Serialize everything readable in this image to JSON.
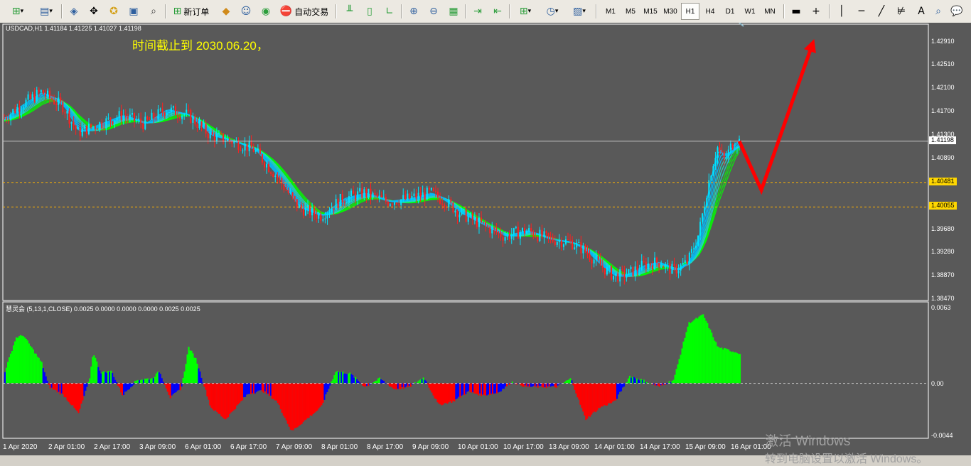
{
  "toolbar": {
    "new_order_label": "新订单",
    "autotrade_label": "自动交易",
    "timeframes": [
      "M1",
      "M5",
      "M15",
      "M30",
      "H1",
      "H4",
      "D1",
      "W1",
      "MN"
    ],
    "active_timeframe": "H1"
  },
  "chart": {
    "symbol_info": "USDCAD,H1  1.41184 1.41225 1.41027 1.41198",
    "annotation": "时间截止到 2030.06.20，",
    "price_labels": [
      "1.42910",
      "1.42510",
      "1.42100",
      "1.41700",
      "1.41300",
      "1.40890",
      "1.39680",
      "1.39280",
      "1.38870",
      "1.38470"
    ],
    "current_price": "1.41198",
    "level_labels": [
      "1.40481",
      "1.40055"
    ],
    "indicator_info": "慧灵会 (5,13,1,CLOSE) 0.0025 0.0000 0.0000 0.0000 0.0025 0.0025",
    "indicator_labels": [
      "0.0063",
      "0.00",
      "-0.0044"
    ],
    "time_labels": [
      "1 Apr 2020",
      "2 Apr 01:00",
      "2 Apr 17:00",
      "3 Apr 09:00",
      "6 Apr 01:00",
      "6 Apr 17:00",
      "7 Apr 09:00",
      "8 Apr 01:00",
      "8 Apr 17:00",
      "9 Apr 09:00",
      "10 Apr 01:00",
      "10 Apr 17:00",
      "13 Apr 09:00",
      "14 Apr 01:00",
      "14 Apr 17:00",
      "15 Apr 09:00",
      "16 Apr 01:00"
    ],
    "watermark_line1": "激活 Windows",
    "watermark_line2": "转到电脑设置以激活 Windows。"
  },
  "colors": {
    "background": "#595959",
    "bull_candle": "#00e5ff",
    "bear_candle": "#ff2020",
    "ribbon_green": "#00ff00",
    "ribbon_blue": "#00bfff",
    "histogram_green": "#00ff00",
    "histogram_red": "#ff0000",
    "histogram_blue": "#0000ff",
    "level_line": "#ffb400",
    "annotation": "#ffff00",
    "forecast_arrow": "#ff0000"
  },
  "chart_data": {
    "type": "candlestick",
    "symbol": "USDCAD",
    "timeframe": "H1",
    "close_path": [
      [
        0,
        1.416
      ],
      [
        0.02,
        1.418
      ],
      [
        0.05,
        1.4205
      ],
      [
        0.08,
        1.418
      ],
      [
        0.1,
        1.4135
      ],
      [
        0.13,
        1.415
      ],
      [
        0.16,
        1.4165
      ],
      [
        0.19,
        1.415
      ],
      [
        0.22,
        1.4175
      ],
      [
        0.25,
        1.4165
      ],
      [
        0.28,
        1.413
      ],
      [
        0.31,
        1.412
      ],
      [
        0.34,
        1.4105
      ],
      [
        0.37,
        1.406
      ],
      [
        0.4,
        1.4005
      ],
      [
        0.43,
        1.399
      ],
      [
        0.46,
        1.402
      ],
      [
        0.49,
        1.403
      ],
      [
        0.52,
        1.4015
      ],
      [
        0.55,
        1.402
      ],
      [
        0.58,
        1.403
      ],
      [
        0.6,
        1.4015
      ],
      [
        0.62,
        1.3995
      ],
      [
        0.65,
        1.3975
      ],
      [
        0.68,
        1.3955
      ],
      [
        0.71,
        1.3965
      ],
      [
        0.74,
        1.395
      ],
      [
        0.77,
        1.3945
      ],
      [
        0.79,
        1.393
      ],
      [
        0.81,
        1.3905
      ],
      [
        0.83,
        1.3885
      ],
      [
        0.85,
        1.389
      ],
      [
        0.87,
        1.3905
      ],
      [
        0.89,
        1.391
      ],
      [
        0.91,
        1.3895
      ],
      [
        0.93,
        1.391
      ],
      [
        0.945,
        1.396
      ],
      [
        0.96,
        1.406
      ],
      [
        0.97,
        1.411
      ],
      [
        0.98,
        1.4085
      ],
      [
        0.99,
        1.4115
      ],
      [
        1.0,
        1.412
      ]
    ],
    "forecast_path": [
      [
        1.0,
        1.41198
      ],
      [
        1.03,
        1.4035
      ],
      [
        1.1,
        1.429
      ]
    ],
    "levels": [
      1.40481,
      1.40055
    ],
    "current_price": 1.41198,
    "ylim": [
      1.3847,
      1.4313
    ],
    "indicator": {
      "name": "慧灵会",
      "path": [
        [
          0,
          0.001
        ],
        [
          0.015,
          0.0038
        ],
        [
          0.025,
          0.004
        ],
        [
          0.05,
          0.0017
        ],
        [
          0.06,
          -0.0003
        ],
        [
          0.08,
          -0.001
        ],
        [
          0.1,
          -0.0025
        ],
        [
          0.115,
          0.0003
        ],
        [
          0.12,
          0.0026
        ],
        [
          0.13,
          0.0009
        ],
        [
          0.145,
          0.001
        ],
        [
          0.16,
          -0.001
        ],
        [
          0.18,
          0.0003
        ],
        [
          0.2,
          0.0004
        ],
        [
          0.21,
          0.001
        ],
        [
          0.225,
          -0.0012
        ],
        [
          0.24,
          -0.0004
        ],
        [
          0.25,
          0.003
        ],
        [
          0.26,
          0.002
        ],
        [
          0.28,
          -0.002
        ],
        [
          0.3,
          -0.003
        ],
        [
          0.33,
          -0.0009
        ],
        [
          0.35,
          -0.0006
        ],
        [
          0.37,
          -0.0015
        ],
        [
          0.39,
          -0.004
        ],
        [
          0.41,
          -0.003
        ],
        [
          0.43,
          -0.002
        ],
        [
          0.45,
          0.001
        ],
        [
          0.47,
          0.0008
        ],
        [
          0.49,
          -0.0003
        ],
        [
          0.51,
          0.0004
        ],
        [
          0.53,
          -0.0005
        ],
        [
          0.55,
          -0.0003
        ],
        [
          0.57,
          0.0005
        ],
        [
          0.59,
          -0.0018
        ],
        [
          0.61,
          -0.0015
        ],
        [
          0.63,
          -0.0007
        ],
        [
          0.65,
          -0.001
        ],
        [
          0.67,
          -0.0008
        ],
        [
          0.69,
          0.0001
        ],
        [
          0.71,
          -0.0003
        ],
        [
          0.73,
          -0.0003
        ],
        [
          0.75,
          -0.0003
        ],
        [
          0.77,
          0.0004
        ],
        [
          0.79,
          -0.003
        ],
        [
          0.81,
          -0.002
        ],
        [
          0.83,
          -0.0015
        ],
        [
          0.85,
          0.0006
        ],
        [
          0.87,
          0.0002
        ],
        [
          0.89,
          -0.0003
        ],
        [
          0.91,
          0.0003
        ],
        [
          0.93,
          0.005
        ],
        [
          0.95,
          0.0057
        ],
        [
          0.97,
          0.003
        ],
        [
          1.0,
          0.0025
        ]
      ],
      "ylim": [
        -0.0044,
        0.0063
      ]
    }
  }
}
